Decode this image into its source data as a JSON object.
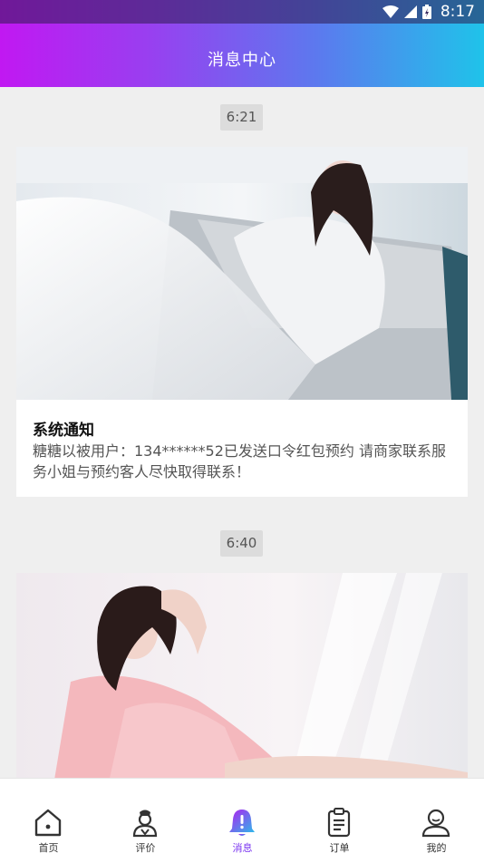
{
  "status_bar": {
    "time": "8:17"
  },
  "header": {
    "title": "消息中心"
  },
  "messages": [
    {
      "time": "6:21",
      "title": "系统通知",
      "body": "糖糖以被用户：134******52已发送口令红包预约 请商家联系服务小姐与预约客人尽快取得联系！"
    },
    {
      "time": "6:40",
      "title": "",
      "body": ""
    }
  ],
  "tabs": [
    {
      "label": "首页",
      "icon": "home-icon"
    },
    {
      "label": "评价",
      "icon": "reviewer-icon"
    },
    {
      "label": "消息",
      "icon": "bell-icon",
      "active": true
    },
    {
      "label": "订单",
      "icon": "clipboard-icon"
    },
    {
      "label": "我的",
      "icon": "user-icon"
    }
  ],
  "colors": {
    "gradient_start": "#c118f2",
    "gradient_end": "#1fc3ea",
    "active_tab": "#7a34f0"
  }
}
